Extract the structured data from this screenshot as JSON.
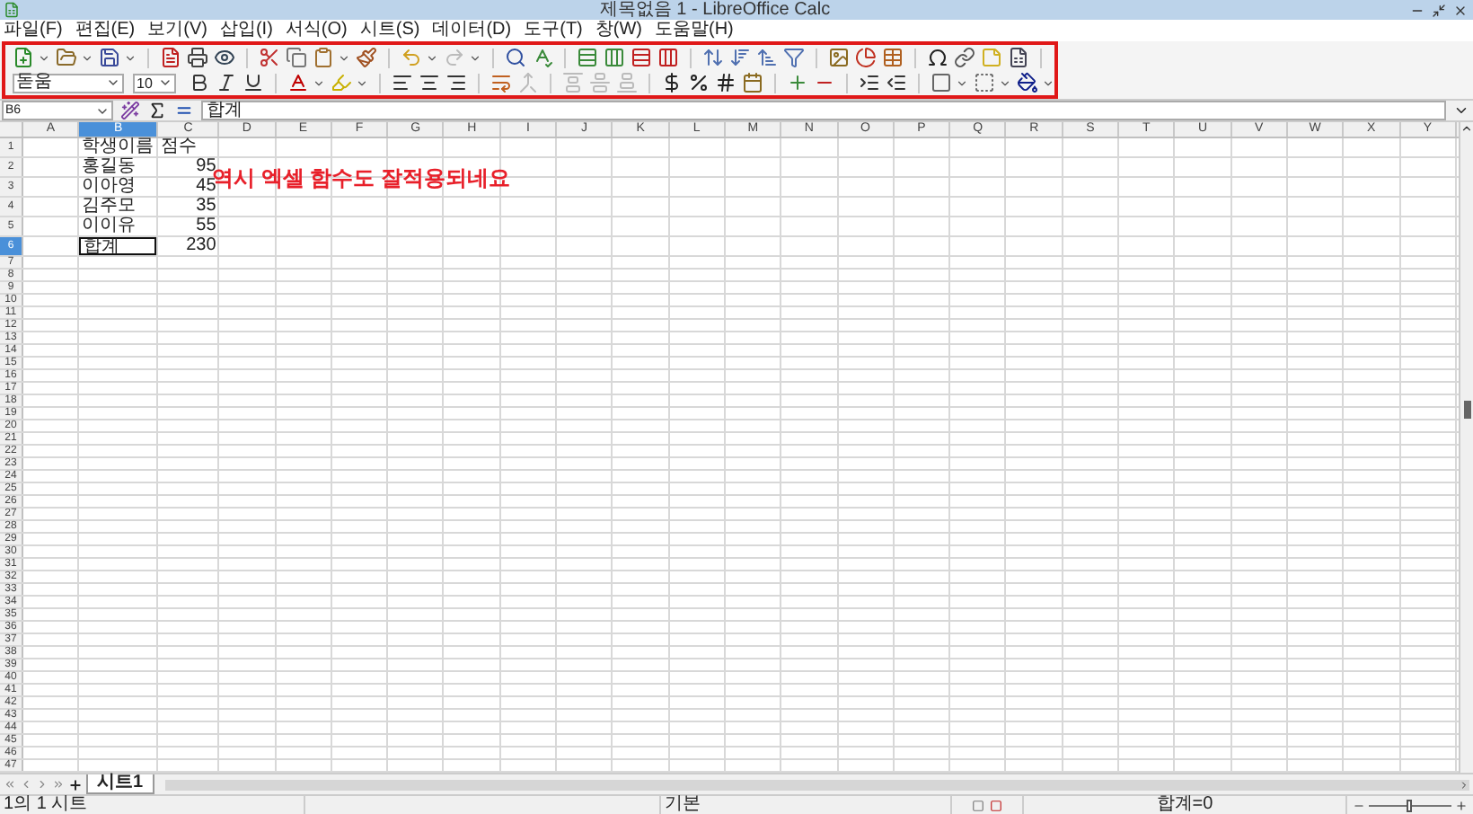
{
  "window": {
    "title": "제목없음 1 - LibreOffice Calc"
  },
  "menu": [
    "파일(F)",
    "편집(E)",
    "보기(V)",
    "삽입(I)",
    "서식(O)",
    "시트(S)",
    "데이터(D)",
    "도구(T)",
    "창(W)",
    "도움말(H)"
  ],
  "formatting": {
    "font_name": "돋움",
    "font_size": "10"
  },
  "formula_bar": {
    "name_box": "B6",
    "formula": "합계"
  },
  "columns": [
    {
      "label": "A",
      "selected": false
    },
    {
      "label": "B",
      "selected": true
    },
    {
      "label": "C",
      "selected": false
    },
    {
      "label": "D",
      "selected": false
    },
    {
      "label": "E",
      "selected": false
    },
    {
      "label": "F",
      "selected": false
    },
    {
      "label": "G",
      "selected": false
    },
    {
      "label": "H",
      "selected": false
    },
    {
      "label": "I",
      "selected": false
    },
    {
      "label": "J",
      "selected": false
    },
    {
      "label": "K",
      "selected": false
    },
    {
      "label": "L",
      "selected": false
    },
    {
      "label": "M",
      "selected": false
    },
    {
      "label": "N",
      "selected": false
    },
    {
      "label": "O",
      "selected": false
    },
    {
      "label": "P",
      "selected": false
    },
    {
      "label": "Q",
      "selected": false
    },
    {
      "label": "R",
      "selected": false
    },
    {
      "label": "S",
      "selected": false
    },
    {
      "label": "T",
      "selected": false
    },
    {
      "label": "U",
      "selected": false
    },
    {
      "label": "V",
      "selected": false
    },
    {
      "label": "W",
      "selected": false
    },
    {
      "label": "X",
      "selected": false
    },
    {
      "label": "Y",
      "selected": false
    }
  ],
  "rows": [
    {
      "label": "1",
      "selected": false,
      "cells": [
        null,
        {
          "text": "학생이름",
          "kind": "text",
          "active": false
        },
        {
          "text": "점수",
          "kind": "text",
          "active": false
        }
      ]
    },
    {
      "label": "2",
      "selected": false,
      "cells": [
        null,
        {
          "text": "홍길동",
          "kind": "text",
          "active": false
        },
        {
          "text": "95",
          "kind": "number",
          "active": false
        }
      ]
    },
    {
      "label": "3",
      "selected": false,
      "cells": [
        null,
        {
          "text": "이아영",
          "kind": "text",
          "active": false
        },
        {
          "text": "45",
          "kind": "number",
          "active": false
        }
      ]
    },
    {
      "label": "4",
      "selected": false,
      "cells": [
        null,
        {
          "text": "김주모",
          "kind": "text",
          "active": false
        },
        {
          "text": "35",
          "kind": "number",
          "active": false
        }
      ]
    },
    {
      "label": "5",
      "selected": false,
      "cells": [
        null,
        {
          "text": "이이유",
          "kind": "text",
          "active": false
        },
        {
          "text": "55",
          "kind": "number",
          "active": false
        }
      ]
    },
    {
      "label": "6",
      "selected": true,
      "cells": [
        null,
        {
          "text": "합계",
          "kind": "text",
          "active": true
        },
        {
          "text": "230",
          "kind": "number",
          "active": false
        }
      ]
    },
    {
      "label": "7",
      "selected": false
    },
    {
      "label": "8",
      "selected": false
    },
    {
      "label": "9",
      "selected": false
    },
    {
      "label": "10",
      "selected": false
    },
    {
      "label": "11",
      "selected": false
    },
    {
      "label": "12",
      "selected": false
    },
    {
      "label": "13",
      "selected": false
    },
    {
      "label": "14",
      "selected": false
    },
    {
      "label": "15",
      "selected": false
    },
    {
      "label": "16",
      "selected": false
    },
    {
      "label": "17",
      "selected": false
    },
    {
      "label": "18",
      "selected": false
    },
    {
      "label": "19",
      "selected": false
    },
    {
      "label": "20",
      "selected": false
    },
    {
      "label": "21",
      "selected": false
    },
    {
      "label": "22",
      "selected": false
    },
    {
      "label": "23",
      "selected": false
    },
    {
      "label": "24",
      "selected": false
    },
    {
      "label": "25",
      "selected": false
    },
    {
      "label": "26",
      "selected": false
    },
    {
      "label": "27",
      "selected": false
    },
    {
      "label": "28",
      "selected": false
    },
    {
      "label": "29",
      "selected": false
    },
    {
      "label": "30",
      "selected": false
    },
    {
      "label": "31",
      "selected": false
    },
    {
      "label": "32",
      "selected": false
    },
    {
      "label": "33",
      "selected": false
    },
    {
      "label": "34",
      "selected": false
    },
    {
      "label": "35",
      "selected": false
    },
    {
      "label": "36",
      "selected": false
    },
    {
      "label": "37",
      "selected": false
    },
    {
      "label": "38",
      "selected": false
    },
    {
      "label": "39",
      "selected": false
    },
    {
      "label": "40",
      "selected": false
    },
    {
      "label": "41",
      "selected": false
    },
    {
      "label": "42",
      "selected": false
    },
    {
      "label": "43",
      "selected": false
    },
    {
      "label": "44",
      "selected": false
    },
    {
      "label": "45",
      "selected": false
    },
    {
      "label": "46",
      "selected": false
    },
    {
      "label": "47",
      "selected": false
    }
  ],
  "annotation": {
    "text": "역시 엑셀 함수도 잘적용되네요"
  },
  "sheet_tabs": [
    {
      "label": "시트1",
      "selected": true
    }
  ],
  "status_bar": {
    "sheet": "1의 1 시트",
    "page_style": "기본",
    "sum": "합계=0",
    "zoom": {
      "level": 0.5
    }
  }
}
